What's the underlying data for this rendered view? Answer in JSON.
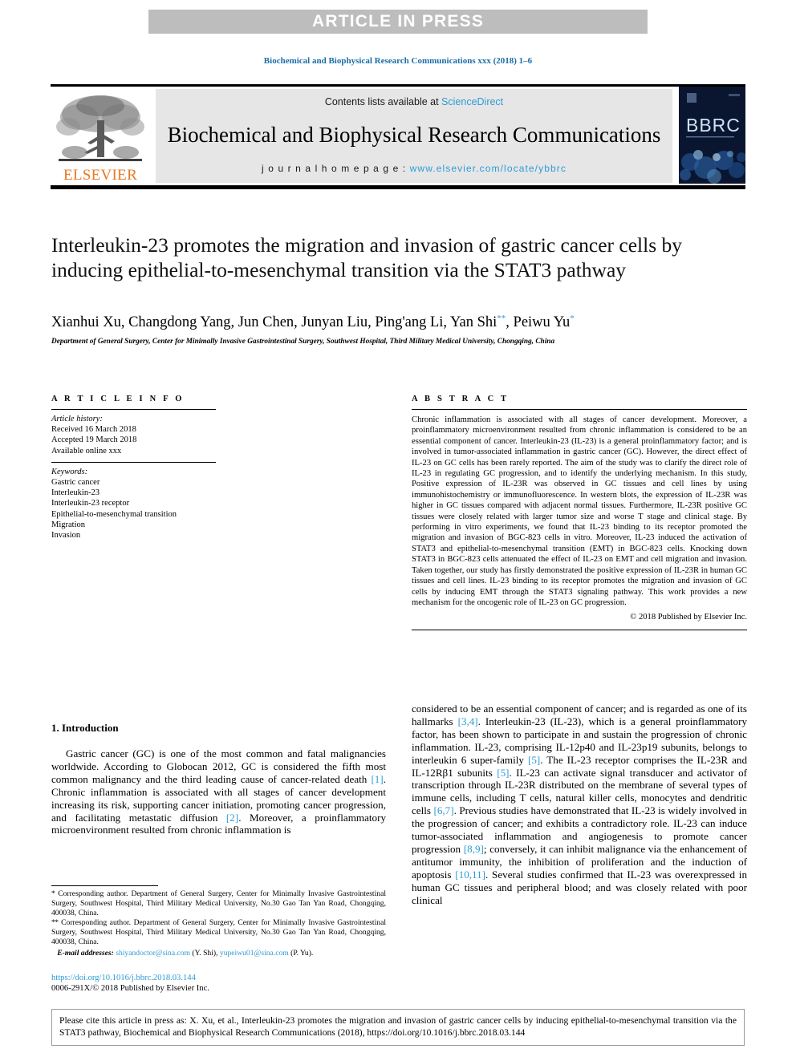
{
  "banner": {
    "label": "ARTICLE IN PRESS"
  },
  "running_head": "Biochemical and Biophysical Research Communications xxx (2018) 1–6",
  "masthead": {
    "contents_prefix": "Contents lists available at ",
    "sciencedirect": "ScienceDirect",
    "journal_title": "Biochemical and Biophysical Research Communications",
    "homepage_prefix": "j o u r n a l   h o m e p a g e :   ",
    "homepage_url": "www.elsevier.com/locate/ybbrc",
    "publisher_wordmark": "ELSEVIER",
    "cover_title": "BBRC",
    "accent_link": "#2e9bd6",
    "accent_publisher": "#E87722",
    "banner_gray": "#bdbdbd",
    "masthead_gray": "#e6e6e6",
    "cover_navy": "#0a1630"
  },
  "article": {
    "title": "Interleukin-23 promotes the migration and invasion of gastric cancer cells by inducing epithelial-to-mesenchymal transition via the STAT3 pathway",
    "authors_plain": "Xianhui Xu, Changdong Yang, Jun Chen, Junyan Liu, Ping'ang Li, Yan Shi",
    "author_last": ", Peiwu Yu",
    "marker_double": "**",
    "marker_single": "*",
    "affiliation": "Department of General Surgery, Center for Minimally Invasive Gastrointestinal Surgery, Southwest Hospital, Third Military Medical University, Chongqing, China"
  },
  "info": {
    "heading": "A R T I C L E   I N F O",
    "history_label": "Article history:",
    "history": [
      "Received 16 March 2018",
      "Accepted 19 March 2018",
      "Available online xxx"
    ],
    "keywords_label": "Keywords:",
    "keywords": [
      "Gastric cancer",
      "Interleukin-23",
      "Interleukin-23 receptor",
      "Epithelial-to-mesenchymal transition",
      "Migration",
      "Invasion"
    ]
  },
  "abstract": {
    "heading": "A B S T R A C T",
    "text": "Chronic inflammation is associated with all stages of cancer development. Moreover, a proinflammatory microenvironment resulted from chronic inflammation is considered to be an essential component of cancer. Interleukin-23 (IL-23) is a general proinflammatory factor; and is involved in tumor-associated inflammation in gastric cancer (GC). However, the direct effect of IL-23 on GC cells has been rarely reported. The aim of the study was to clarify the direct role of IL-23 in regulating GC progression, and to identify the underlying mechanism. In this study, Positive expression of IL-23R was observed in GC tissues and cell lines by using immunohistochemistry or immunofluorescence. In western blots, the expression of IL-23R was higher in GC tissues compared with adjacent normal tissues. Furthermore, IL-23R positive GC tissues were closely related with larger tumor size and worse T stage and clinical stage. By performing in vitro experiments, we found that IL-23 binding to its receptor promoted the migration and invasion of BGC-823 cells in vitro. Moreover, IL-23 induced the activation of STAT3 and epithelial-to-mesenchymal transition (EMT) in BGC-823 cells. Knocking down STAT3 in BGC-823 cells attenuated the effect of IL-23 on EMT and cell migration and invasion. Taken together, our study has firstly demonstrated the positive expression of IL-23R in human GC tissues and cell lines. IL-23 binding to its receptor promotes the migration and invasion of GC cells by inducing EMT through the STAT3 signaling pathway. This work provides a new mechanism for the oncogenic role of IL-23 on GC progression.",
    "copyright": "© 2018 Published by Elsevier Inc."
  },
  "body": {
    "section_heading": "1.  Introduction",
    "left_paragraph_a": "Gastric cancer (GC) is one of the most common and fatal malignancies worldwide. According to Globocan 2012, GC is considered the fifth most common malignancy and the third leading cause of cancer-related death ",
    "ref_1": "[1]",
    "left_paragraph_b": ". Chronic inflammation is associated with all stages of cancer development increasing its risk, supporting cancer initiation, promoting cancer progression, and facilitating metastatic diffusion ",
    "ref_2": "[2]",
    "left_paragraph_c": ". Moreover, a proinflammatory microenvironment resulted from chronic inflammation is",
    "right_a": "considered to be an essential component of cancer; and is regarded as one of its hallmarks ",
    "ref_34": "[3,4]",
    "right_b": ". Interleukin-23 (IL-23), which is a general proinflammatory factor, has been shown to participate in and sustain the progression of chronic inflammation. IL-23, comprising IL-12p40 and IL-23p19 subunits, belongs to interleukin 6 super-family ",
    "ref_5a": "[5]",
    "right_c": ". The IL-23 receptor comprises the IL-23R and IL-12Rβ1 subunits ",
    "ref_5b": "[5]",
    "right_d": ". IL-23 can activate signal transducer and activator of transcription through IL-23R distributed on the membrane of several types of immune cells, including T cells, natural killer cells, monocytes and dendritic cells ",
    "ref_67": "[6,7]",
    "right_e": ". Previous studies have demonstrated that IL-23 is widely involved in the progression of cancer; and exhibits a contradictory role. IL-23 can induce tumor-associated inflammation and angiogenesis to promote cancer progression ",
    "ref_89": "[8,9]",
    "right_f": "; conversely, it can inhibit malignance via the enhancement of antitumor immunity, the inhibition of proliferation and the induction of apoptosis ",
    "ref_1011": "[10,11]",
    "right_g": ". Several studies confirmed that IL-23 was overexpressed in human GC tissues and peripheral blood; and was closely related with poor clinical"
  },
  "footnotes": {
    "corr1_marker": "*",
    "corr1": " Corresponding author. Department of General Surgery, Center for Minimally Invasive Gastrointestinal Surgery, Southwest Hospital, Third Military Medical University, No.30 Gao Tan Yan Road, Chongqing, 400038, China.",
    "corr2_marker": "**",
    "corr2": " Corresponding author. Department of General Surgery, Center for Minimally Invasive Gastrointestinal Surgery, Southwest Hospital, Third Military Medical University, No.30 Gao Tan Yan Road, Chongqing, 400038, China.",
    "email_label": "E-mail addresses:",
    "email1": "shiyandoctor@sina.com",
    "email1_owner": "(Y. Shi)",
    "email2": "yupeiwu01@sina.com",
    "email2_owner": "(P. Yu).",
    "doi": "https://doi.org/10.1016/j.bbrc.2018.03.144",
    "issn_line": "0006-291X/© 2018 Published by Elsevier Inc."
  },
  "cite_box": {
    "text": "Please cite this article in press as: X. Xu, et al., Interleukin-23 promotes the migration and invasion of gastric cancer cells by inducing epithelial-to-mesenchymal transition via the STAT3 pathway, Biochemical and Biophysical Research Communications (2018), https://doi.org/10.1016/j.bbrc.2018.03.144"
  }
}
